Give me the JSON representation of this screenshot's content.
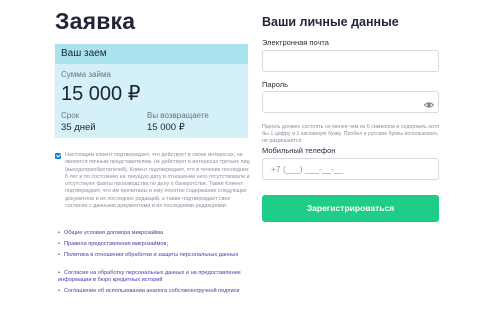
{
  "page": {
    "title": "Заявка"
  },
  "loan": {
    "header": "Ваш заем",
    "amount_label": "Сумма займа",
    "amount_value": "15 000 ₽",
    "term_label": "Срок",
    "term_value": "35 дней",
    "return_label": "Вы возвращаете",
    "return_value": "15 000 ₽"
  },
  "consent": {
    "checked": true,
    "text": "Настоящим клиент подтверждает, что действует в своих интересах, не является личным представителем, не действует в интересах третьих лиц (выгодоприобретателей). Клиент подтверждает, что в течение последних 5 лет и по состоянию на текущую дату в отношении него отсутствовали и отсутствуют факты производства по делу о банкротстве. Также Клиент подтверждает, что им прочитаны и ему понятно содержание следующих документов и их последних редакций, а также подтверждает свое согласие с данными документами и их последними редакциями:"
  },
  "documents": [
    "Общие условия договора микрозайма",
    "Правила предоставления микрозаймов;",
    "Политика в отношении обработки и защиты персональных данных",
    "Согласие на обработку персональных данных и на предоставление информации в бюро кредитных историй",
    "Соглашение об использовании аналога собственноручной подписи"
  ],
  "form": {
    "title": "Ваши личные данные",
    "email_label": "Электронная почта",
    "email_value": "",
    "password_label": "Пароль",
    "password_value": "",
    "password_hint": "Пароль должен состоять не менее чем из 6 символов и содержать хотя бы 1 цифру и 1 заглавную букву. Пробел и русские буквы использовать не разрешается",
    "phone_label": "Мобильный телефон",
    "phone_placeholder": "+7 (___) ___-__-__",
    "submit_label": "Зарегистрироваться"
  },
  "colors": {
    "card_bg": "#d4f1f7",
    "card_header": "#a9e3ee",
    "submit": "#1dcd88",
    "link": "#4a3aa8",
    "checkbox": "#1d7ec8"
  },
  "icons": {
    "password_toggle": "eye-icon"
  }
}
